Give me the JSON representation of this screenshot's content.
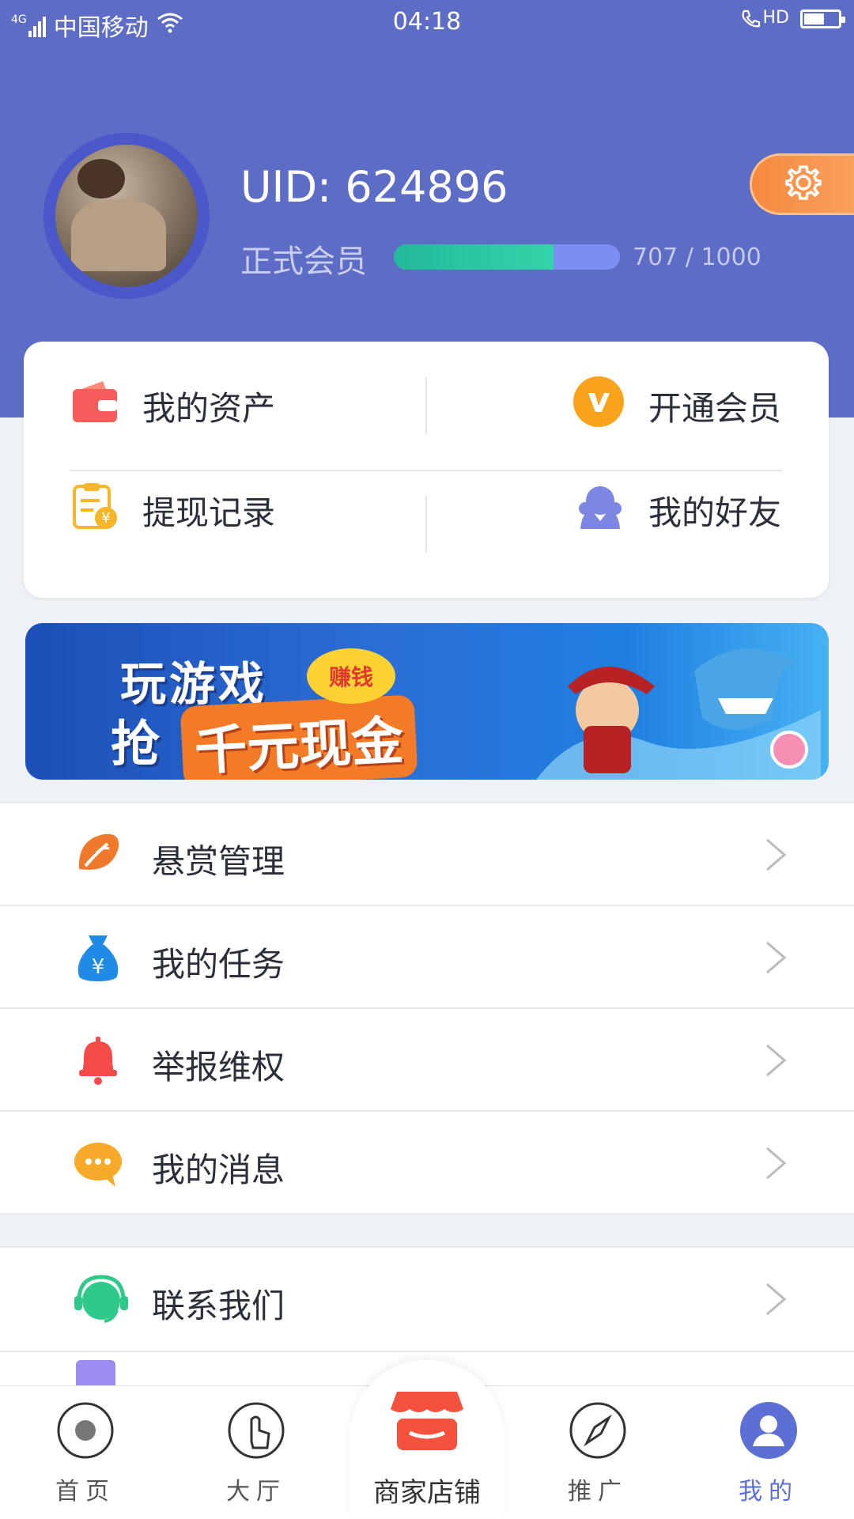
{
  "status_bar": {
    "network": "4G",
    "carrier": "中国移动",
    "time": "04:18",
    "hd": "HD",
    "battery_level": 0.55
  },
  "profile": {
    "uid": "UID: 624896",
    "member_level": "正式会员",
    "progress_text": "707 / 1000",
    "progress_value": 707,
    "progress_max": 1000
  },
  "quick_actions": [
    {
      "label": "我的资产",
      "icon": "wallet-icon"
    },
    {
      "label": "开通会员",
      "icon": "vip-icon"
    },
    {
      "label": "提现记录",
      "icon": "withdraw-record-icon"
    },
    {
      "label": "我的好友",
      "icon": "friends-icon"
    }
  ],
  "banner": {
    "line1": "玩游戏",
    "line2_prefix": "抢",
    "line2_highlight": "千元现金",
    "badge": "赚钱"
  },
  "menu": [
    {
      "label": "悬赏管理",
      "icon": "feather-icon"
    },
    {
      "label": "我的任务",
      "icon": "money-bag-icon"
    },
    {
      "label": "举报维权",
      "icon": "bell-icon"
    },
    {
      "label": "我的消息",
      "icon": "message-icon"
    }
  ],
  "menu2": [
    {
      "label": "联系我们",
      "icon": "headset-icon"
    }
  ],
  "bottom_nav": [
    {
      "label": "首页",
      "icon": "home-icon",
      "active": false
    },
    {
      "label": "大厅",
      "icon": "hall-icon",
      "active": false
    },
    {
      "label": "商家店铺",
      "icon": "shop-icon",
      "active": false
    },
    {
      "label": "推广",
      "icon": "compass-icon",
      "active": false
    },
    {
      "label": "我的",
      "icon": "profile-icon",
      "active": true
    }
  ],
  "colors": {
    "header": "#5d6cc5",
    "accent_blue": "#3e6fe0",
    "active_nav": "#5b6fd4",
    "orange": "#f6893f"
  }
}
